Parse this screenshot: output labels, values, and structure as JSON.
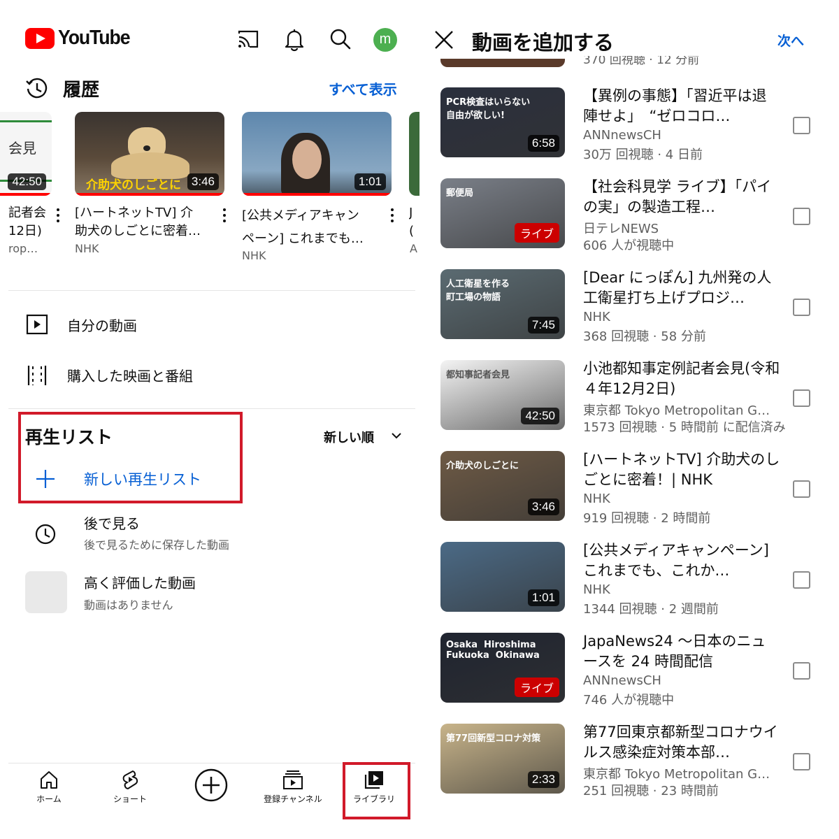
{
  "header": {
    "logo_text": "YouTube",
    "avatar_letter": "m"
  },
  "history": {
    "title": "履歴",
    "show_all": "すべて表示",
    "partial_left": {
      "title_line1": "記者会",
      "title_line2": "12日)",
      "sub": "rop…",
      "duration": "42:50",
      "thumb_text": "会見"
    },
    "items": [
      {
        "title_line1": "[ハートネットTV] 介",
        "title_line2": "助犬のしごとに密着…",
        "channel": "NHK",
        "duration": "3:46",
        "overlay": "介助犬のしごとに"
      },
      {
        "title_line1": "[公共メディアキャン",
        "title_line2": "ペーン] これまでも…",
        "channel": "NHK",
        "duration": "1:01"
      }
    ],
    "partial_right": {
      "l1": "J",
      "l2": "(",
      "l3": "A"
    }
  },
  "menu": [
    {
      "label": "自分の動画",
      "icon": "play-box-icon"
    },
    {
      "label": "購入した映画と番組",
      "icon": "film-strip-icon"
    }
  ],
  "playlists": {
    "title": "再生リスト",
    "sort_label": "新しい順",
    "new_label": "新しい再生リスト",
    "items": [
      {
        "name": "後で見る",
        "sub": "後で見るために保存した動画"
      },
      {
        "name": "高く評価した動画",
        "sub": "動画はありません"
      }
    ]
  },
  "bottom_nav": [
    {
      "label": "ホーム",
      "icon": "home-icon"
    },
    {
      "label": "ショート",
      "icon": "shorts-icon"
    },
    {
      "label": "",
      "icon": "create-plus-icon"
    },
    {
      "label": "登録チャンネル",
      "icon": "subscriptions-icon"
    },
    {
      "label": "ライブラリ",
      "icon": "library-icon"
    }
  ],
  "add_videos": {
    "title": "動画を追加する",
    "next": "次へ",
    "peek_meta": "370 回視聴 · 12 分前",
    "videos": [
      {
        "title": "【異例の事態】「習近平は退陣せよ」　“ゼロコロ…",
        "channel": "ANNnewsCH",
        "meta": "30万 回視聴 · 4 日前",
        "duration": "6:58",
        "live": false,
        "caption": "PCR検査はいらない\n自由が欲しい!",
        "bg": "#2a2f3d"
      },
      {
        "title": "【社会科見学 ライブ】「パイの実」の製造工程…",
        "channel": "日テレNEWS",
        "meta": "606 人が視聴中",
        "live_label": "ライブ",
        "live": true,
        "caption": "郵便局",
        "bg": "#7a7f88"
      },
      {
        "title": "[Dear にっぽん] 九州発の人工衛星打ち上げプロジ…",
        "channel": "NHK",
        "meta": "368 回視聴 · 58 分前",
        "duration": "7:45",
        "live": false,
        "caption": "人工衛星を作る\n町工場の物語",
        "bg": "#5b6b72"
      },
      {
        "title": "小池都知事定例記者会見(令和４年12月2日)",
        "channel": "東京都 Tokyo Metropolitan G…",
        "meta": "1573 回視聴 · 5 時間前 に配信済み",
        "duration": "42:50",
        "live": false,
        "caption": "都知事記者会見",
        "bg": "#f4f4f4"
      },
      {
        "title": "[ハートネットTV] 介助犬のしごとに密着！| NHK",
        "channel": "NHK",
        "meta": "919 回視聴 · 2 時間前",
        "duration": "3:46",
        "live": false,
        "caption": "介助犬のしごとに",
        "bg": "#6e5a45"
      },
      {
        "title": "[公共メディアキャンペーン] これまでも、これか…",
        "channel": "NHK",
        "meta": "1344 回視聴 · 2 週間前",
        "duration": "1:01",
        "live": false,
        "caption": "",
        "bg": "#4b6a86"
      },
      {
        "title": "JapaNews24 ～日本のニュースを 24 時間配信",
        "channel": "ANNnewsCH",
        "meta": "746 人が視聴中",
        "live_label": "ライブ",
        "live": true,
        "caption": "Osaka  Hiroshima\nFukuoka  Okinawa",
        "bg": "#1f2430"
      },
      {
        "title": "第77回東京都新型コロナウイルス感染症対策本部…",
        "channel": "東京都 Tokyo Metropolitan G…",
        "meta": "251 回視聴 · 23 時間前",
        "duration": "2:33",
        "live": false,
        "caption": "第77回新型コロナ対策",
        "bg": "#c8b48a"
      }
    ]
  },
  "colors": {
    "accent_blue": "#065fd4",
    "youtube_red": "#ff0000",
    "highlight_box": "#d11a2a"
  }
}
